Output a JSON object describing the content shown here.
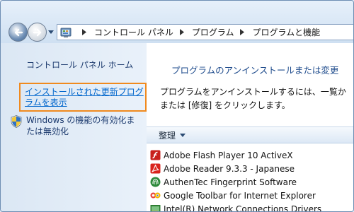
{
  "breadcrumbs": [
    "コントロール パネル",
    "プログラム",
    "プログラムと機能"
  ],
  "sidebar": {
    "home_link": "コントロール パネル ホーム",
    "view_updates_link": "インストールされた更新プログラムを表示",
    "windows_features_link": "Windows の機能の有効化または無効化"
  },
  "main": {
    "heading": "プログラムのアンインストールまたは変更",
    "instruction_line1": "プログラムをアンインストールするには、一覧か",
    "instruction_line2": "または [修復] をクリックします。",
    "organize_button": "整理"
  },
  "programs": [
    {
      "name": "Adobe Flash Player 10 ActiveX",
      "icon": "flash-icon"
    },
    {
      "name": "Adobe Reader 9.3.3 - Japanese",
      "icon": "adobe-reader-icon"
    },
    {
      "name": "AuthenTec Fingerprint Software",
      "icon": "fingerprint-icon"
    },
    {
      "name": "Google Toolbar for Internet Explorer",
      "icon": "google-toolbar-icon"
    },
    {
      "name": "Intel(R) Network Connections Drivers",
      "icon": "intel-network-icon"
    }
  ],
  "colors": {
    "highlight_border": "#f08a1e",
    "link_blue": "#0066cc",
    "sidebar_bg": "#dbe7f4",
    "heading_blue": "#1e4b8c"
  }
}
